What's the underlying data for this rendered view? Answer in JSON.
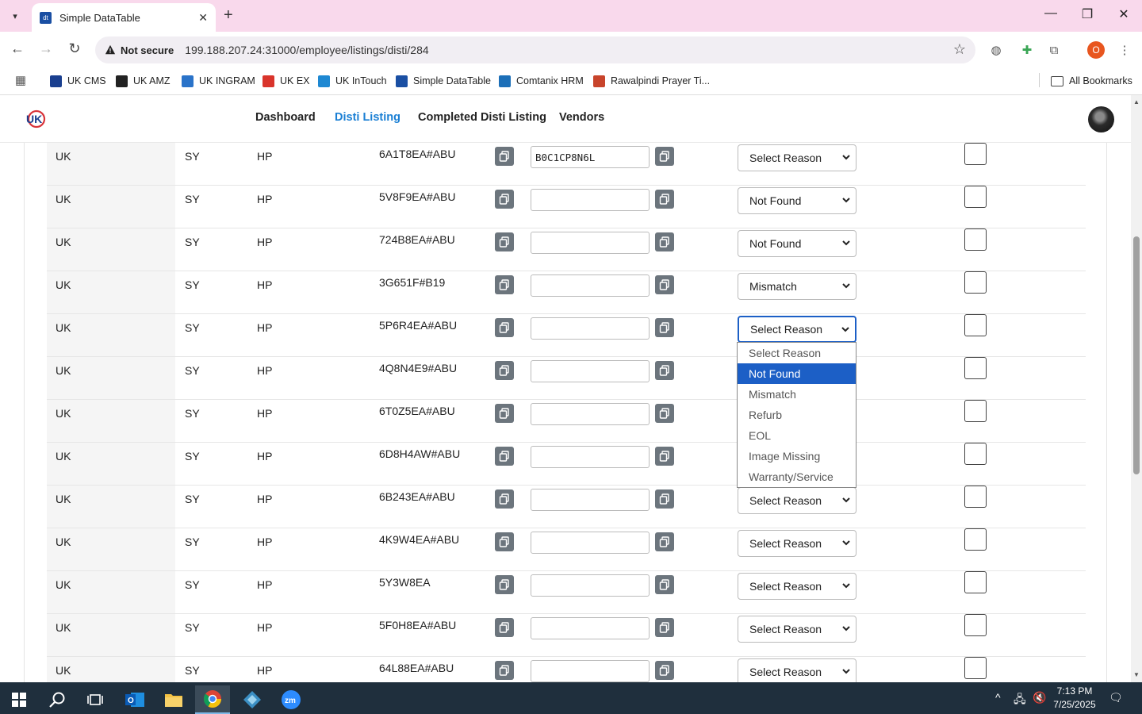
{
  "browser": {
    "tab_title": "Simple DataTable",
    "tab_favicon_text": "dt",
    "security_label": "Not secure",
    "url": "199.188.207.24:31000/employee/listings/disti/284",
    "profile_initial": "O",
    "bookmarks": [
      {
        "label": "UK CMS",
        "icon": "dt",
        "color": "#1a3f8f"
      },
      {
        "label": "UK AMZ",
        "icon": "a",
        "color": "#222222"
      },
      {
        "label": "UK INGRAM",
        "icon": "ing",
        "color": "#2a73c9"
      },
      {
        "label": "UK EX",
        "icon": "ex",
        "color": "#d9342b"
      },
      {
        "label": "UK InTouch",
        "icon": "c",
        "color": "#1e88d2"
      },
      {
        "label": "Simple DataTable",
        "icon": "dt",
        "color": "#1a4fa3"
      },
      {
        "label": "Comtanix HRM",
        "icon": "o",
        "color": "#1c6fb8"
      },
      {
        "label": "Rawalpindi Prayer Ti...",
        "icon": "h",
        "color": "#c8442b"
      }
    ],
    "all_bookmarks": "All Bookmarks"
  },
  "nav": {
    "links": [
      "Dashboard",
      "Disti Listing",
      "Completed Disti Listing",
      "Vendors"
    ],
    "active": "Disti Listing"
  },
  "rows": [
    {
      "region": "UK",
      "code": "SY",
      "brand": "HP",
      "sku": "6A1T8EA#ABU",
      "asin": "B0C1CP8N6L",
      "reason": "Select Reason"
    },
    {
      "region": "UK",
      "code": "SY",
      "brand": "HP",
      "sku": "5V8F9EA#ABU",
      "asin": "",
      "reason": "Not Found"
    },
    {
      "region": "UK",
      "code": "SY",
      "brand": "HP",
      "sku": "724B8EA#ABU",
      "asin": "",
      "reason": "Not Found"
    },
    {
      "region": "UK",
      "code": "SY",
      "brand": "HP",
      "sku": "3G651F#B19",
      "asin": "",
      "reason": "Mismatch"
    },
    {
      "region": "UK",
      "code": "SY",
      "brand": "HP",
      "sku": "5P6R4EA#ABU",
      "asin": "",
      "reason": "Select Reason"
    },
    {
      "region": "UK",
      "code": "SY",
      "brand": "HP",
      "sku": "4Q8N4E9#ABU",
      "asin": "",
      "reason": ""
    },
    {
      "region": "UK",
      "code": "SY",
      "brand": "HP",
      "sku": "6T0Z5EA#ABU",
      "asin": "",
      "reason": ""
    },
    {
      "region": "UK",
      "code": "SY",
      "brand": "HP",
      "sku": "6D8H4AW#ABU",
      "asin": "",
      "reason": ""
    },
    {
      "region": "UK",
      "code": "SY",
      "brand": "HP",
      "sku": "6B243EA#ABU",
      "asin": "",
      "reason": "Select Reason"
    },
    {
      "region": "UK",
      "code": "SY",
      "brand": "HP",
      "sku": "4K9W4EA#ABU",
      "asin": "",
      "reason": "Select Reason"
    },
    {
      "region": "UK",
      "code": "SY",
      "brand": "HP",
      "sku": "5Y3W8EA",
      "asin": "",
      "reason": "Select Reason"
    },
    {
      "region": "UK",
      "code": "SY",
      "brand": "HP",
      "sku": "5F0H8EA#ABU",
      "asin": "",
      "reason": "Select Reason"
    },
    {
      "region": "UK",
      "code": "SY",
      "brand": "HP",
      "sku": "64L88EA#ABU",
      "asin": "",
      "reason": "Select Reason"
    }
  ],
  "dropdown": {
    "options": [
      "Select Reason",
      "Not Found",
      "Mismatch",
      "Refurb",
      "EOL",
      "Image Missing",
      "Warranty/Service"
    ],
    "highlighted": "Not Found"
  },
  "taskbar": {
    "time": "7:13 PM",
    "date": "7/25/2025"
  },
  "colors": {
    "tab_strip": "#f9d9ec",
    "accent": "#1c5fc6",
    "nav_active": "#1a7fd4",
    "copy_button": "#6c757d"
  }
}
